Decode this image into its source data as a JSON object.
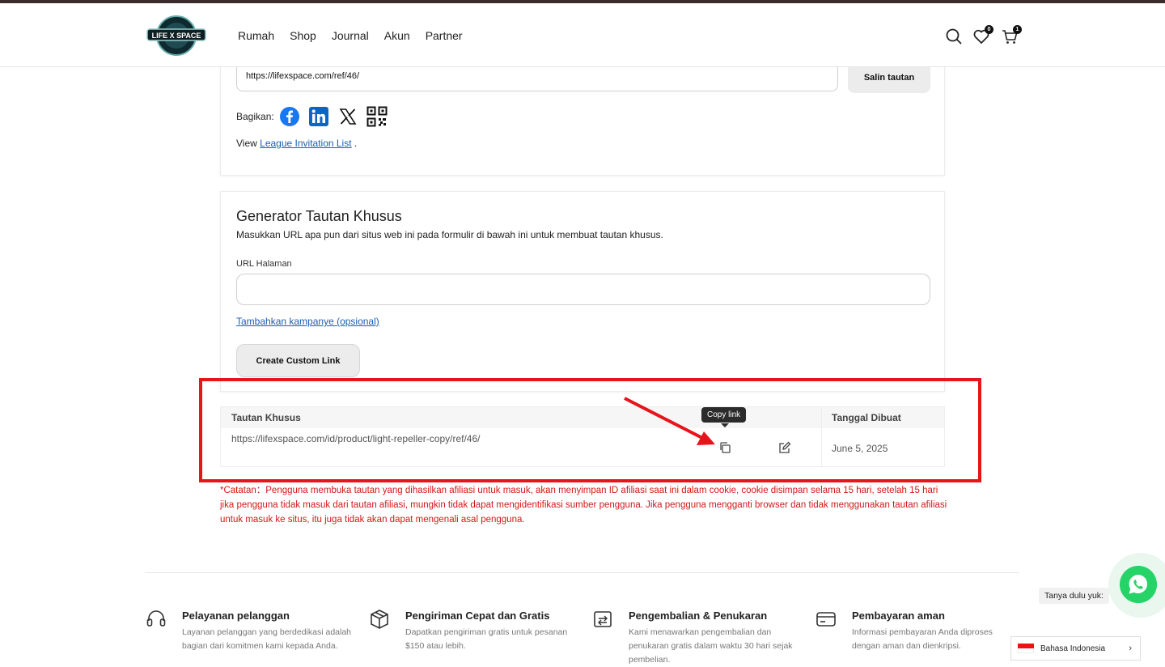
{
  "header": {
    "nav": [
      "Rumah",
      "Shop",
      "Journal",
      "Akun",
      "Partner"
    ],
    "wishlist_count": "0",
    "cart_count": "1",
    "logo_text": "LIFE X SPACE"
  },
  "referral": {
    "link_value": "https://lifexspace.com/ref/46/",
    "copy_label": "Salin tautan",
    "share_label": "Bagikan:",
    "share_icons": [
      "facebook-icon",
      "linkedin-icon",
      "x-icon",
      "qr-code-icon"
    ],
    "view_prefix": "View",
    "view_link": "League Invitation List",
    "view_suffix": "."
  },
  "generator": {
    "title": "Generator Tautan Khusus",
    "description": "Masukkan URL apa pun dari situs web ini pada formulir di bawah ini untuk membuat tautan khusus.",
    "url_label": "URL Halaman",
    "url_value": "",
    "campaign_link": "Tambahkan kampanye (opsional)",
    "create_button": "Create Custom Link"
  },
  "links_table": {
    "headers": [
      "Tautan Khusus",
      "Tanggal Dibuat"
    ],
    "rows": [
      {
        "url": "https://lifexspace.com/id/product/light-repeller-copy/ref/46/",
        "date": "June 5, 2025"
      }
    ],
    "tooltip": "Copy link"
  },
  "note": "*Catatan：Pengguna membuka tautan yang dihasilkan afiliasi untuk masuk, akan menyimpan ID afiliasi saat ini dalam cookie, cookie disimpan selama 15 hari, setelah 15 hari jika pengguna tidak masuk dari tautan afiliasi, mungkin tidak dapat mengidentifikasi sumber pengguna. Jika pengguna mengganti browser dan tidak menggunakan tautan afiliasi untuk masuk ke situs, itu juga tidak akan dapat mengenali asal pengguna.",
  "features": [
    {
      "icon": "headset-icon",
      "title": "Pelayanan pelanggan",
      "desc": "Layanan pelanggan yang berdedikasi adalah bagian dari komitmen kami kepada Anda."
    },
    {
      "icon": "box-icon",
      "title": "Pengiriman Cepat dan Gratis",
      "desc": "Dapatkan pengiriman gratis untuk pesanan $150 atau lebih."
    },
    {
      "icon": "return-icon",
      "title": "Pengembalian & Penukaran",
      "desc": "Kami menawarkan pengembalian dan penukaran gratis dalam waktu 30 hari sejak pembelian."
    },
    {
      "icon": "card-icon",
      "title": "Pembayaran aman",
      "desc": "Informasi pembayaran Anda diproses dengan aman dan dienkripsi."
    }
  ],
  "whatsapp_tip": "Tanya dulu yuk:",
  "language": "Bahasa Indonesia",
  "colors": {
    "annotation_red": "#e8141c",
    "note_red": "#d41616",
    "link_blue": "#1a5fb4",
    "whatsapp_green": "#25d366"
  }
}
